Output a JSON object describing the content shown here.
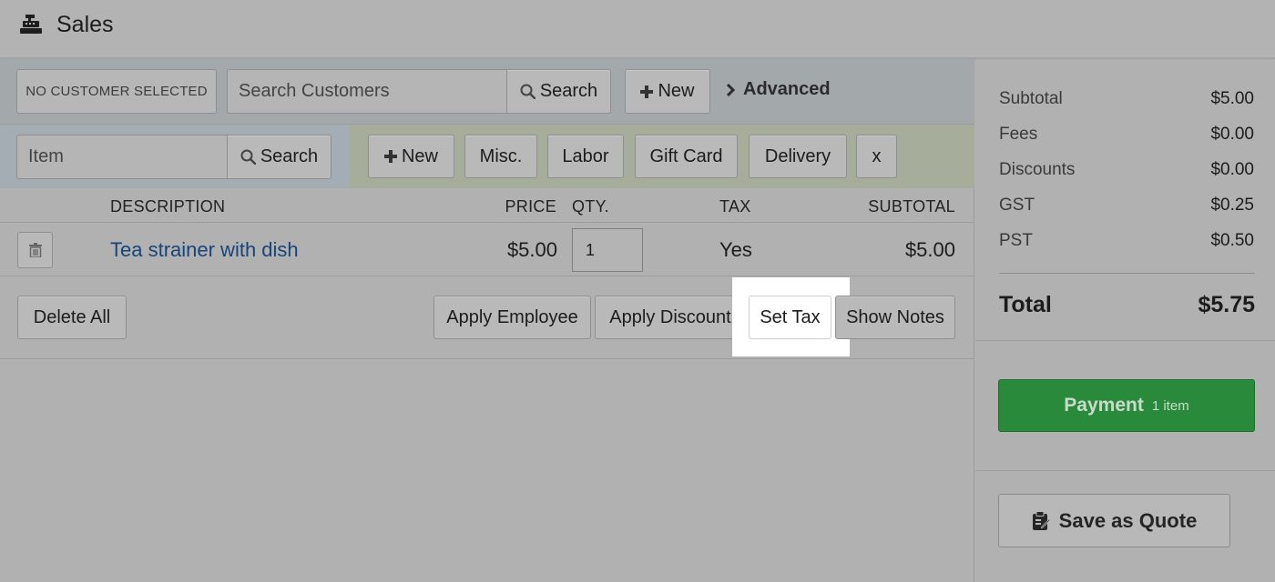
{
  "header": {
    "title": "Sales",
    "icon": "cash-register-icon"
  },
  "customer": {
    "selected_label": "NO CUSTOMER SELECTED",
    "search_placeholder": "Search Customers",
    "search_label": "Search",
    "new_label": "New",
    "advanced_label": "Advanced"
  },
  "item_bar": {
    "search_placeholder": "Item",
    "search_label": "Search",
    "new_label": "New",
    "misc_label": "Misc.",
    "labor_label": "Labor",
    "gift_card_label": "Gift Card",
    "delivery_label": "Delivery",
    "close_label": "x"
  },
  "table": {
    "columns": {
      "description": "DESCRIPTION",
      "price": "PRICE",
      "qty": "QTY.",
      "tax": "TAX",
      "subtotal": "SUBTOTAL"
    },
    "rows": [
      {
        "description": "Tea strainer with dish",
        "price": "$5.00",
        "qty": "1",
        "tax": "Yes",
        "subtotal": "$5.00"
      }
    ]
  },
  "actions": {
    "delete_all": "Delete All",
    "apply_employee": "Apply Employee",
    "apply_discount": "Apply Discount",
    "set_tax": "Set Tax",
    "show_notes": "Show Notes"
  },
  "summary": {
    "subtotal_label": "Subtotal",
    "subtotal": "$5.00",
    "fees_label": "Fees",
    "fees": "$0.00",
    "discounts_label": "Discounts",
    "discounts": "$0.00",
    "gst_label": "GST",
    "gst": "$0.25",
    "pst_label": "PST",
    "pst": "$0.50",
    "total_label": "Total",
    "total": "$5.75"
  },
  "payment": {
    "label": "Payment",
    "count": "1 item",
    "color": "#2a8a3c"
  },
  "quote": {
    "label": "Save as Quote",
    "icon": "clipboard-icon"
  }
}
